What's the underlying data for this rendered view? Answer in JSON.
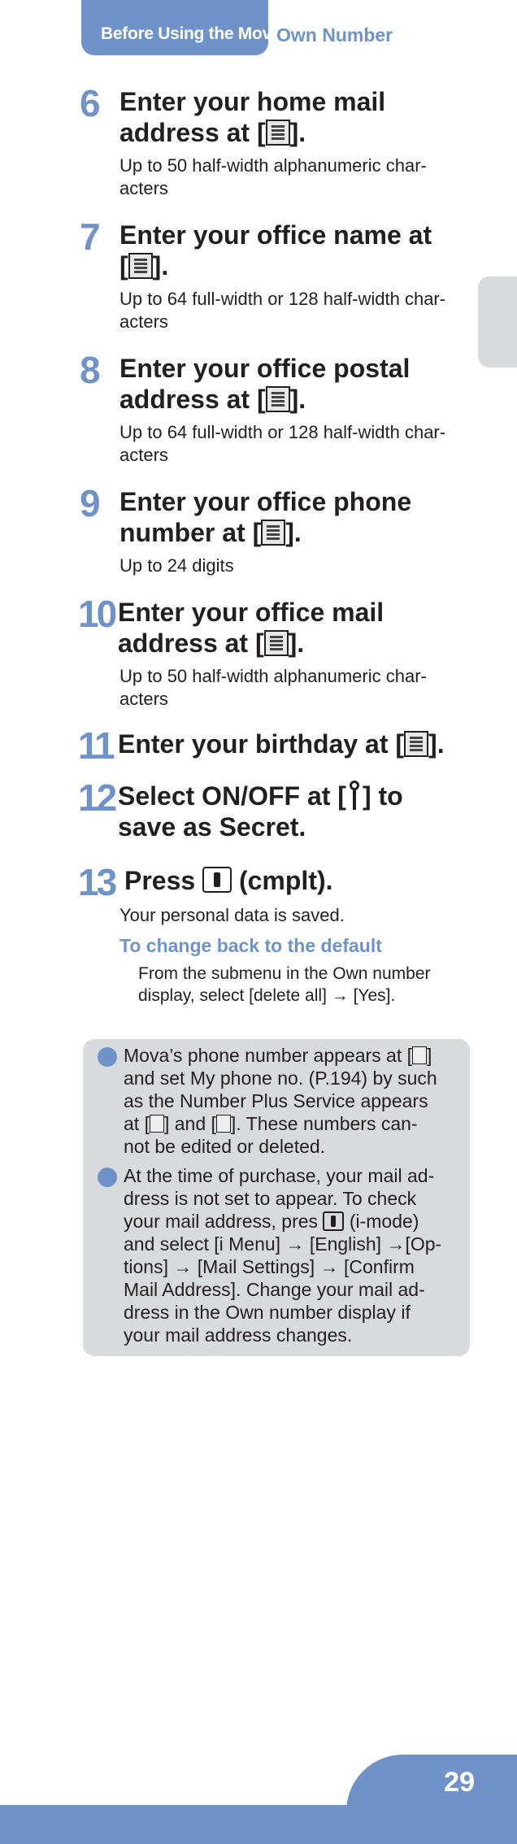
{
  "header": {
    "tab_label": "Before Using the Mova",
    "title": "Own Number"
  },
  "steps": [
    {
      "num": "6",
      "title_a": "Enter your home mail",
      "title_b": "address at [",
      "title_c": "].",
      "desc_a": "Up to 50 half-width alphanumeric char-",
      "desc_b": "acters"
    },
    {
      "num": "7",
      "title_a": "Enter your office name at",
      "title_b": "[",
      "title_c": "].",
      "desc_a": "Up to 64 full-width or 128 half-width char-",
      "desc_b": "acters"
    },
    {
      "num": "8",
      "title_a": "Enter your office postal",
      "title_b": "address at [",
      "title_c": "].",
      "desc_a": "Up to 64 full-width or 128 half-width char-",
      "desc_b": "acters"
    },
    {
      "num": "9",
      "title_a": "Enter your office phone",
      "title_b": "number at [",
      "title_c": "].",
      "desc_a": "Up to 24 digits",
      "desc_b": ""
    },
    {
      "num": "10",
      "title_a": "Enter your office mail",
      "title_b": "address at [",
      "title_c": "].",
      "desc_a": "Up to 50 half-width alphanumeric char-",
      "desc_b": "acters"
    },
    {
      "num": "11",
      "title_a": "Enter your birthday at [",
      "title_b": "",
      "title_c": "]."
    },
    {
      "num": "12",
      "title_a": "Select ON/OFF at [",
      "title_b": "",
      "title_c": "] to",
      "title_d": "save as Secret."
    },
    {
      "num": "13",
      "title_a": "Press",
      "title_b": "",
      "title_c": "(cmplt).",
      "desc_a": "Your personal data is saved."
    }
  ],
  "default_section": {
    "heading": "To change back to the default",
    "body_a": "From the submenu in the Own number",
    "body_b": "display, select [delete all] → [Yes]."
  },
  "notes": [
    {
      "l1a": "Mova’s phone number appears at [",
      "l1b": "]",
      "l2": "and set My phone no. (P.194) by such",
      "l3": "as the Number Plus Service appears",
      "l4a": "at [",
      "l4b": "] and [",
      "l4c": "]. These numbers can-",
      "l5": "not be edited or deleted."
    },
    {
      "l1": "At the time of purchase, your mail ad-",
      "l2": "dress is not set to appear. To check",
      "l3a": "your mail address, pres",
      "l3b": "(i-mode)",
      "l4": "and select [i Menu] → [English] →[Op-",
      "l5": "tions] → [Mail Settings] → [Confirm",
      "l6": "Mail Address]. Change your mail ad-",
      "l7": "dress in the Own number display if",
      "l8": "your mail address changes."
    }
  ],
  "footer": {
    "page_number": "29"
  },
  "icons": [
    "home-mail-icon",
    "office-name-icon",
    "office-postal-icon",
    "office-phone-icon",
    "office-mail-icon",
    "birthday-icon",
    "secret-key-icon",
    "center-button-icon",
    "phone-number-icon"
  ],
  "colors": {
    "accent": "#6f93c8",
    "note_bg": "#d9dadb",
    "text": "#231f20"
  }
}
